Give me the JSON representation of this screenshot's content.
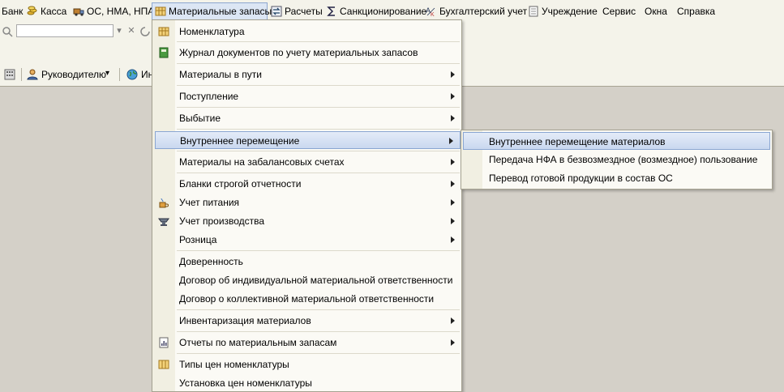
{
  "menubar": {
    "items": [
      {
        "label": "Банк"
      },
      {
        "label": "Касса",
        "icon": "coins-icon"
      },
      {
        "label": "ОС, НМА, НПА",
        "icon": "truck-icon"
      },
      {
        "label": "Материальные запасы",
        "icon": "grid-icon"
      },
      {
        "label": "Расчеты",
        "icon": "exchange-icon"
      },
      {
        "label": "Санкционирование",
        "icon": "sum-icon"
      },
      {
        "label": "Бухгалтерский учет",
        "icon": "accounting-icon"
      },
      {
        "label": "Учреждение",
        "icon": "document-icon"
      },
      {
        "label": "Сервис"
      },
      {
        "label": "Окна"
      },
      {
        "label": "Справка"
      }
    ]
  },
  "search": {
    "value": ""
  },
  "toolbar": {
    "items": [
      {
        "label": "Руководителю",
        "icon": "manager-icon"
      },
      {
        "label": "Ин",
        "icon": "globe-icon"
      }
    ]
  },
  "dropdown": {
    "items": [
      {
        "label": "Номенклатура",
        "icon": "grid-icon",
        "submenu": false
      },
      {
        "label": "Журнал документов по учету материальных запасов",
        "icon": "journal-icon",
        "submenu": false
      },
      {
        "label": "Материалы в пути",
        "submenu": true
      },
      {
        "label": "Поступление",
        "submenu": true
      },
      {
        "label": "Выбытие",
        "submenu": true
      },
      {
        "label": "Внутреннее перемещение",
        "submenu": true,
        "active": true
      },
      {
        "label": "Материалы на забалансовых счетах",
        "submenu": true
      },
      {
        "label": "Бланки строгой отчетности",
        "submenu": true
      },
      {
        "label": "Учет питания",
        "icon": "food-icon",
        "submenu": true
      },
      {
        "label": "Учет производства",
        "icon": "anvil-icon",
        "submenu": true
      },
      {
        "label": "Розница",
        "submenu": true
      },
      {
        "label": "Доверенность",
        "submenu": false
      },
      {
        "label": "Договор об индивидуальной материальной ответственности",
        "submenu": false
      },
      {
        "label": "Договор о коллективной материальной ответственности",
        "submenu": false
      },
      {
        "label": "Инвентаризация материалов",
        "submenu": true
      },
      {
        "label": "Отчеты по материальным запасам",
        "icon": "report-icon",
        "submenu": true
      },
      {
        "label": "Типы цен номенклатуры",
        "icon": "table-icon",
        "submenu": false
      },
      {
        "label": "Установка цен номенклатуры",
        "submenu": false
      }
    ]
  },
  "submenu": {
    "items": [
      {
        "label": "Внутреннее перемещение материалов",
        "active": true
      },
      {
        "label": "Передача НФА в безвозмездное (возмездное) пользование"
      },
      {
        "label": "Перевод готовой продукции в состав ОС"
      }
    ]
  },
  "colors": {
    "highlight": "#c9d8ef",
    "background": "#d4d0c8",
    "menu": "#fbfaf5"
  }
}
